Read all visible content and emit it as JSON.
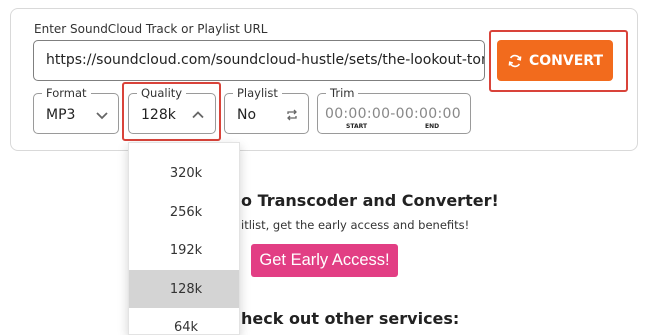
{
  "form": {
    "url_label": "Enter SoundCloud Track or Playlist URL",
    "url_value": "https://soundcloud.com/soundcloud-hustle/sets/the-lookout-tomc",
    "convert_label": "CONVERT",
    "format": {
      "legend": "Format",
      "value": "MP3"
    },
    "quality": {
      "legend": "Quality",
      "value": "128k"
    },
    "playlist": {
      "legend": "Playlist",
      "value": "No"
    },
    "trim": {
      "legend": "Trim",
      "value": "00:00:00-00:00:00",
      "start_label": "START",
      "end_label": "END"
    }
  },
  "quality_dropdown": {
    "options": [
      "320k",
      "256k",
      "192k",
      "128k",
      "64k"
    ],
    "selected": "128k"
  },
  "promo": {
    "title": "o Transcoder and Converter!",
    "subtitle": "itlist, get the early access and benefits!",
    "cta_label": "Get Early Access!",
    "services_heading": "heck out other services:"
  },
  "colors": {
    "convert_bg": "#f26b1d",
    "highlight": "#d9433a",
    "cta_bg": "#e23e84",
    "selected_option_bg": "#d4d4d4"
  },
  "icons": {
    "convert": "refresh-icon",
    "format": "chevron-down-icon",
    "quality": "chevron-up-icon",
    "playlist": "repeat-icon"
  }
}
